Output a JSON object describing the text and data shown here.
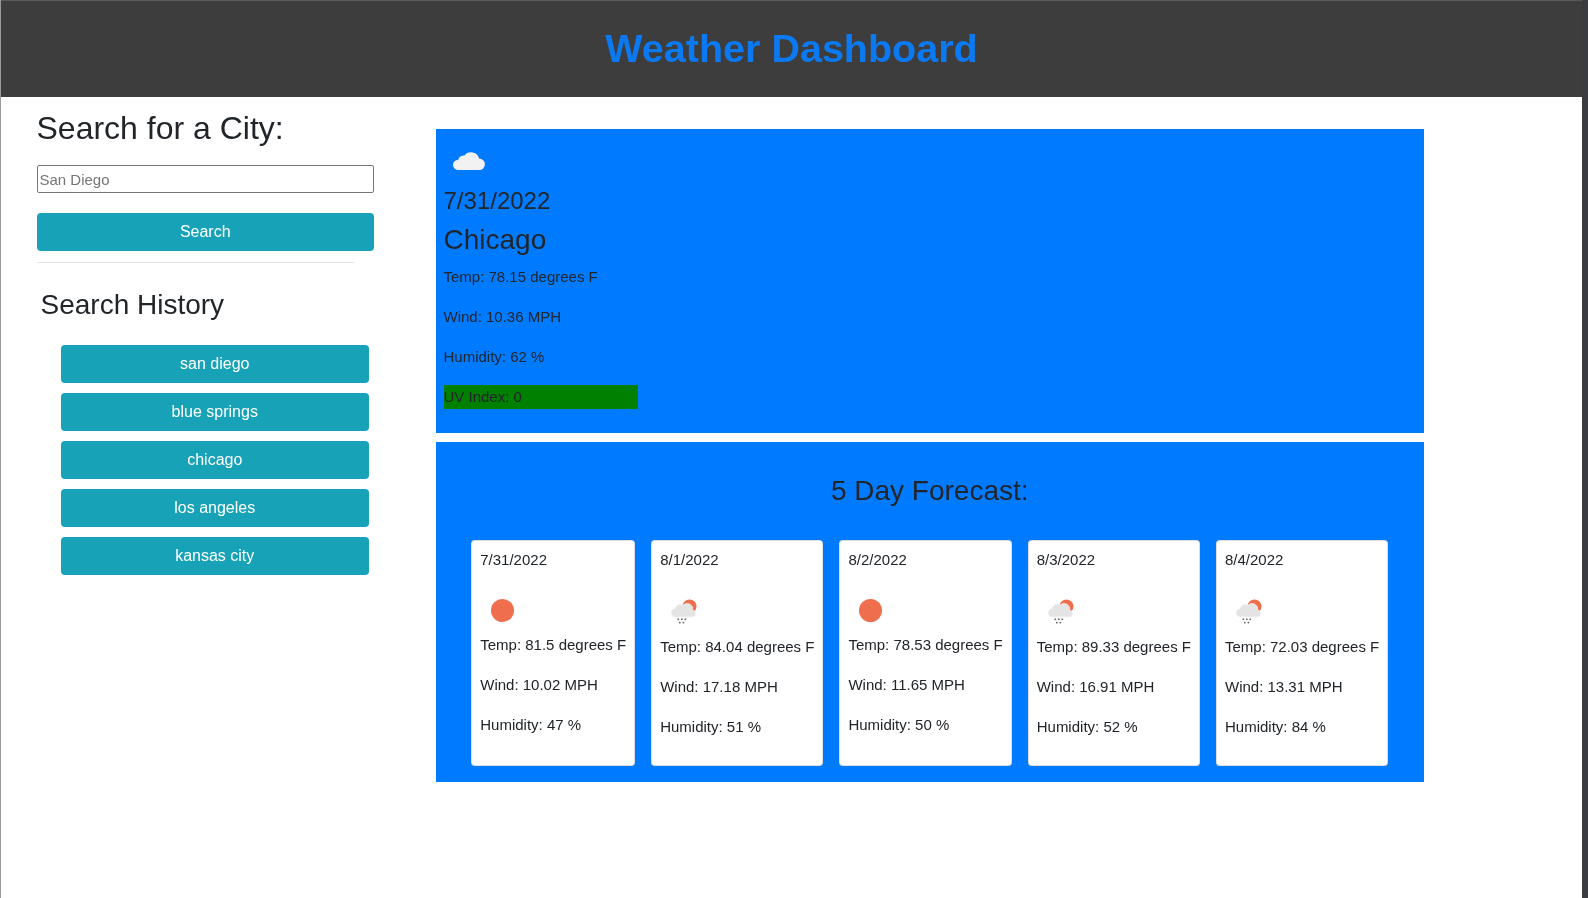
{
  "header": {
    "title": "Weather Dashboard"
  },
  "search": {
    "heading": "Search for a City:",
    "placeholder": "San Diego",
    "button": "Search"
  },
  "history": {
    "heading": "Search History",
    "cities": [
      "san diego",
      "blue springs",
      "chicago",
      "los angeles",
      "kansas city"
    ]
  },
  "current": {
    "date": "7/31/2022",
    "city": "Chicago",
    "temp": "Temp: 78.15 degrees F",
    "wind": "Wind: 10.36 MPH",
    "humidity": "Humidity: 62 %",
    "uv": {
      "text": "UV Index: 0",
      "color": "#008000"
    }
  },
  "forecast": {
    "heading": "5 Day Forecast:",
    "days": [
      {
        "date": "7/31/2022",
        "kind": "sun",
        "temp": "Temp: 81.5 degrees F",
        "wind": "Wind: 10.02 MPH",
        "humidity": "Humidity: 47 %"
      },
      {
        "date": "8/1/2022",
        "kind": "showers",
        "temp": "Temp: 84.04 degrees F",
        "wind": "Wind: 17.18 MPH",
        "humidity": "Humidity: 51 %"
      },
      {
        "date": "8/2/2022",
        "kind": "sun",
        "temp": "Temp: 78.53 degrees F",
        "wind": "Wind: 11.65 MPH",
        "humidity": "Humidity: 50 %"
      },
      {
        "date": "8/3/2022",
        "kind": "showers",
        "temp": "Temp: 89.33 degrees F",
        "wind": "Wind: 16.91 MPH",
        "humidity": "Humidity: 52 %"
      },
      {
        "date": "8/4/2022",
        "kind": "showers",
        "temp": "Temp: 72.03 degrees F",
        "wind": "Wind: 13.31 MPH",
        "humidity": "Humidity: 84 %"
      }
    ]
  }
}
